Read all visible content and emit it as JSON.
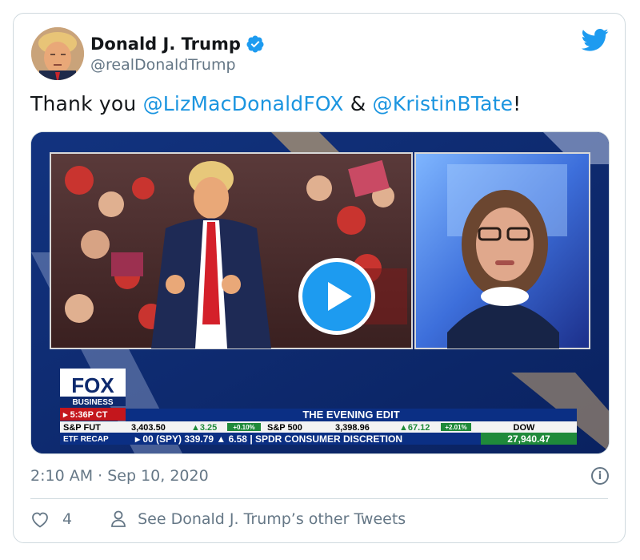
{
  "tweet": {
    "author_name": "Donald J. Trump",
    "author_handle": "@realDonaldTrump",
    "text_prefix": "Thank you ",
    "mention_1": "@LizMacDonaldFOX",
    "text_middle": " & ",
    "mention_2": "@KristinBTate",
    "text_suffix": "!",
    "timestamp": "2:10 AM · Sep 10, 2020",
    "like_count": "4",
    "see_other": "See Donald J. Trump’s other Tweets",
    "info_glyph": "i"
  },
  "video": {
    "network_top": "FOX",
    "network_bottom": "BUSINESS",
    "time": "▸ 5:36P CT",
    "show_title": "THE EVENING EDIT",
    "row1": {
      "label1": "S&P FUT",
      "value1": "3,403.50",
      "change1": "▲3.25",
      "pct1": "+0.10%",
      "label2": "S&P 500",
      "value2": "3,398.96",
      "change2": "▲67.12",
      "pct2": "+2.01%",
      "label3": "DOW"
    },
    "row2": {
      "label": "ETF RECAP",
      "text": "▸ 00 (SPY) 339.79 ▲ 6.58 | SPDR CONSUMER DISCRETION",
      "dow_value": "27,940.47"
    }
  },
  "colors": {
    "accent": "#1d9bf0",
    "link": "#1b95e0",
    "muted": "#657786",
    "fox_navy": "#0e2a6e",
    "ticker_green": "#1f8a3a"
  },
  "icons": [
    "verified-icon",
    "twitter-bird-icon",
    "play-icon",
    "info-icon",
    "heart-icon",
    "person-icon"
  ]
}
